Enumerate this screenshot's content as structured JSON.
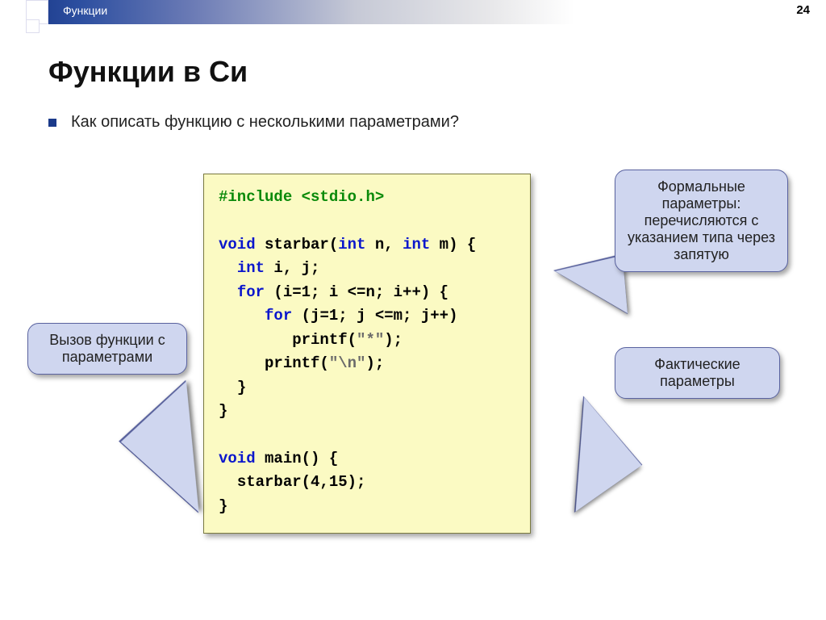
{
  "header": {
    "section_label": "Функции",
    "page_number": "24"
  },
  "title": "Функции в Си",
  "bullet": "Как описать функцию с несколькими параметрами?",
  "code": {
    "l1a": "#include ",
    "l1b": "<stdio.h>",
    "l3a": "void",
    "l3b": " starbar(",
    "l3c": "int",
    "l3d": " n, ",
    "l3e": "int",
    "l3f": " m) {",
    "l4a": "int",
    "l4b": " i, j;",
    "l5a": "for",
    "l5b": " (i=1; i <=n; i++) {",
    "l6a": "for",
    "l6b": " (j=1; j <=m; j++)",
    "l7a": "printf(",
    "l7b": "\"*\"",
    "l7c": ");",
    "l8a": "printf(",
    "l8b": "\"\\n\"",
    "l8c": ");",
    "l9": "}",
    "l10": "}",
    "l12a": "void",
    "l12b": " main() {",
    "l13": "starbar(4,15);",
    "l14": "}"
  },
  "callouts": {
    "formal": "Формальные параметры: перечисляются с указанием типа через запятую",
    "actual": "Фактические параметры",
    "call": "Вызов функции с параметрами"
  }
}
